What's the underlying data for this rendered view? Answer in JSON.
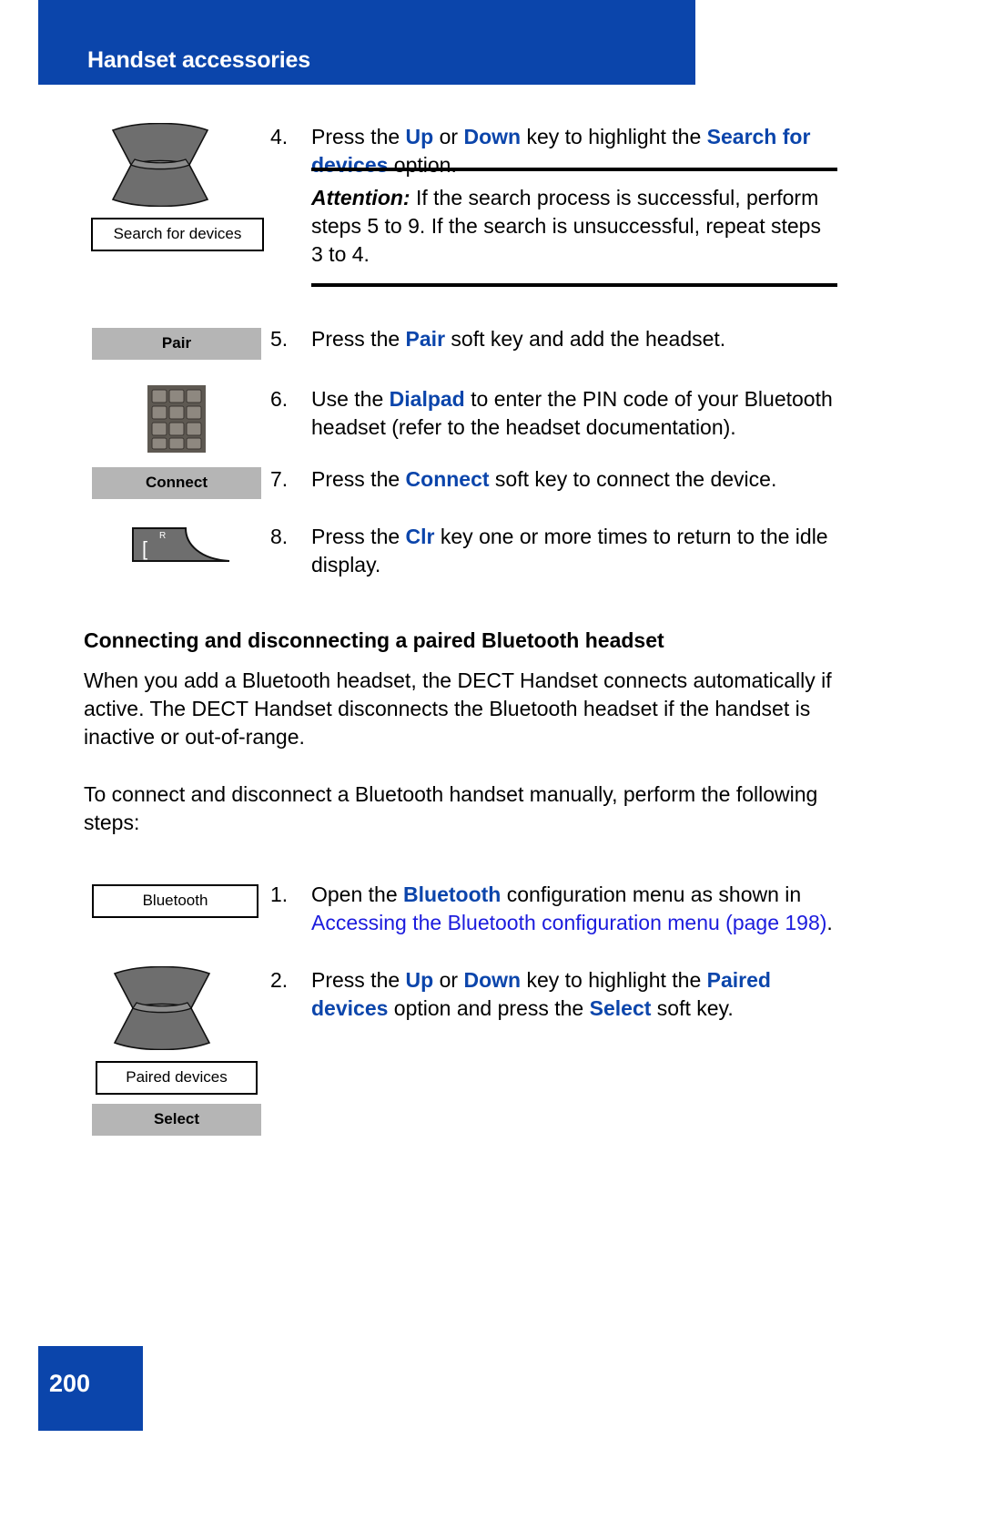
{
  "header": {
    "title": "Handset accessories"
  },
  "icons": {
    "nav_key": "navigation-up-down-key-icon",
    "dialpad": "dialpad-icon",
    "clr_key": "clr-key-icon"
  },
  "steps_top": [
    {
      "number": "4.",
      "parts": [
        {
          "t": "Press the ",
          "style": "plain"
        },
        {
          "t": "Up",
          "style": "bold-blue"
        },
        {
          "t": " or ",
          "style": "plain"
        },
        {
          "t": "Down",
          "style": "bold-blue"
        },
        {
          "t": " key to highlight the ",
          "style": "plain"
        },
        {
          "t": "Search for devices",
          "style": "bold-blue"
        },
        {
          "t": " option.",
          "style": "plain"
        }
      ],
      "display_box": "Search for devices"
    },
    {
      "number": "5.",
      "parts": [
        {
          "t": "Press the ",
          "style": "plain"
        },
        {
          "t": "Pair",
          "style": "bold-blue"
        },
        {
          "t": " soft key and add the headset.",
          "style": "plain"
        }
      ],
      "soft_key": "Pair"
    },
    {
      "number": "6.",
      "parts": [
        {
          "t": "Use the ",
          "style": "plain"
        },
        {
          "t": "Dialpad",
          "style": "bold-blue"
        },
        {
          "t": " to enter the PIN code of your Bluetooth headset (refer to the headset documentation).",
          "style": "plain"
        }
      ]
    },
    {
      "number": "7.",
      "parts": [
        {
          "t": "Press the ",
          "style": "plain"
        },
        {
          "t": "Connect",
          "style": "bold-blue"
        },
        {
          "t": " soft key to connect the device.",
          "style": "plain"
        }
      ],
      "soft_key": "Connect"
    },
    {
      "number": "8.",
      "parts": [
        {
          "t": "Press the ",
          "style": "plain"
        },
        {
          "t": "Clr",
          "style": "bold-blue"
        },
        {
          "t": " key one or more times to return to the idle display.",
          "style": "plain"
        }
      ]
    }
  ],
  "attention": {
    "label": "Attention:",
    "body": " If the search process is successful, perform steps 5 to 9. If the search is unsuccessful, repeat steps 3 to 4."
  },
  "section": {
    "heading": "Connecting and disconnecting a paired Bluetooth headset",
    "paragraph1": "When you add a Bluetooth headset, the DECT Handset connects automatically if active. The DECT Handset disconnects the Bluetooth headset if the handset is inactive or out-of-range.",
    "paragraph2": "To connect and disconnect a Bluetooth handset manually, perform the following steps:"
  },
  "steps_bottom": [
    {
      "number": "1.",
      "display_box": "Bluetooth",
      "parts": [
        {
          "t": "Open the ",
          "style": "plain"
        },
        {
          "t": "Bluetooth",
          "style": "bold-blue"
        },
        {
          "t": " configuration menu as shown in ",
          "style": "plain"
        },
        {
          "t": " Accessing the Bluetooth configuration menu (page 198)",
          "style": "link"
        },
        {
          "t": ".",
          "style": "plain"
        }
      ]
    },
    {
      "number": "2.",
      "display_box": "Paired devices",
      "soft_key": "Select",
      "parts": [
        {
          "t": "Press the ",
          "style": "plain"
        },
        {
          "t": "Up",
          "style": "bold-blue"
        },
        {
          "t": " or ",
          "style": "plain"
        },
        {
          "t": "Down",
          "style": "bold-blue"
        },
        {
          "t": " key to highlight the ",
          "style": "plain"
        },
        {
          "t": "Paired devices",
          "style": "bold-blue"
        },
        {
          "t": " option and press the ",
          "style": "plain"
        },
        {
          "t": "Select",
          "style": "bold-blue"
        },
        {
          "t": " soft key.",
          "style": "plain"
        }
      ]
    }
  ],
  "footer": {
    "page_number": "200"
  },
  "colors": {
    "brand_blue": "#0b45ab",
    "link_blue": "#1b1bdd",
    "soft_key_gray": "#b5b5b5"
  }
}
